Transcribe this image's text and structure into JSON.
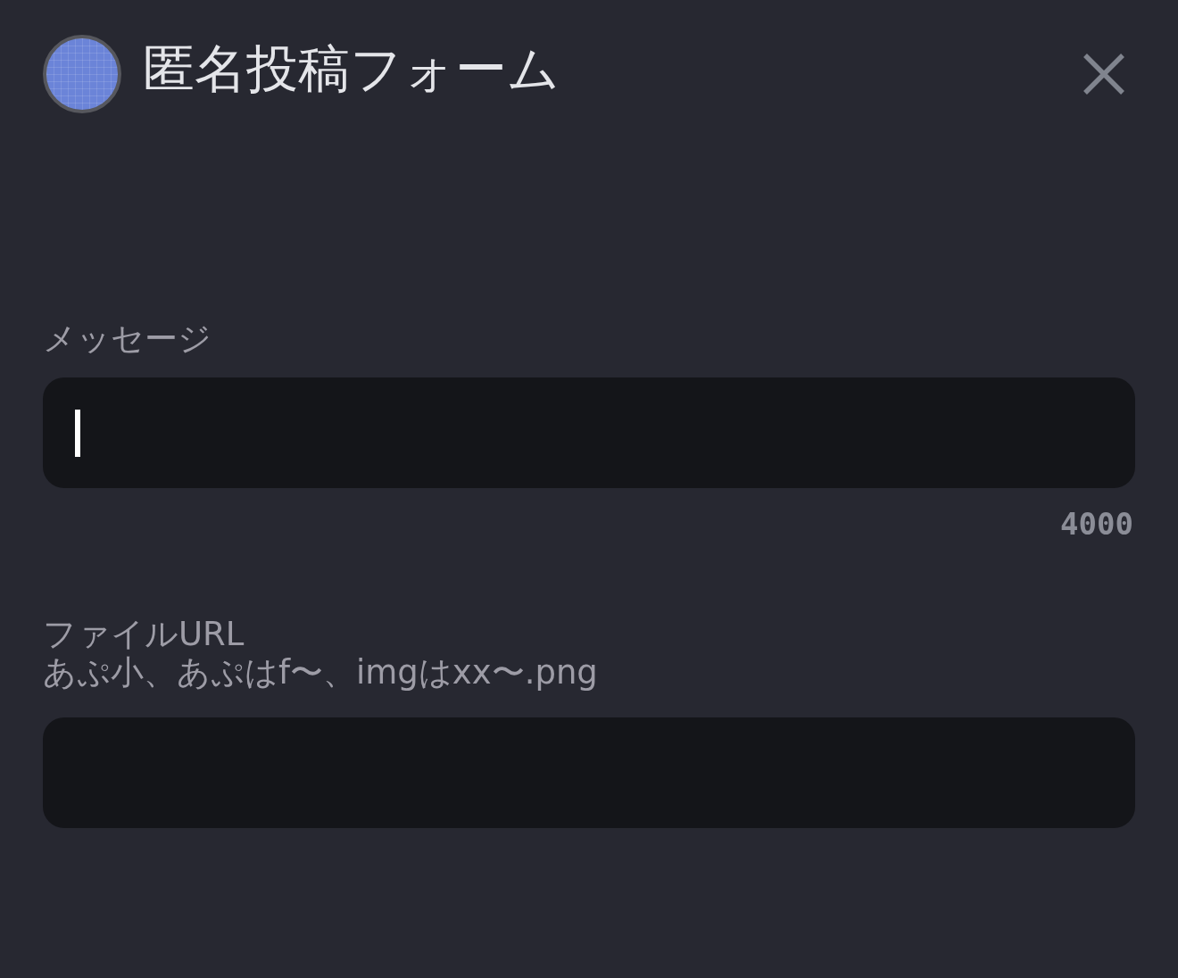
{
  "header": {
    "title": "匿名投稿フォーム"
  },
  "fields": [
    {
      "label": "メッセージ",
      "focused": true,
      "counter": "4000"
    },
    {
      "label": "ファイルURL",
      "hint": "あぷ小、あぷはf〜、imgはxx〜.png",
      "focused": false
    }
  ]
}
